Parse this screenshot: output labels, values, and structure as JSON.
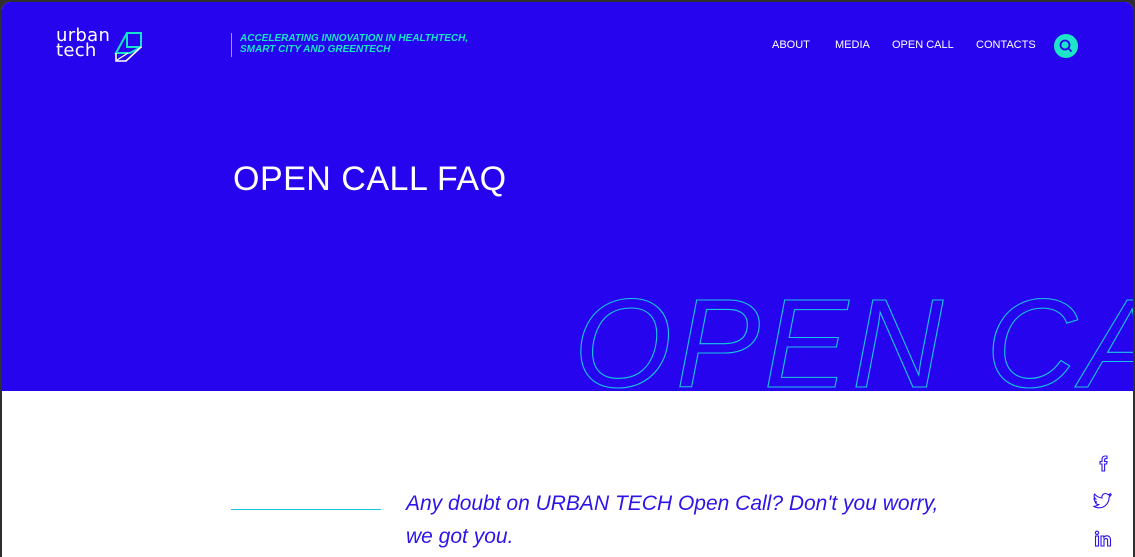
{
  "logo": {
    "line1": "urban",
    "line2": "tech"
  },
  "tagline": {
    "line1": "ACCELERATING INNOVATION IN HEALTHTECH,",
    "line2": "SMART CITY AND GREENTECH"
  },
  "nav": {
    "items": [
      {
        "label": "ABOUT"
      },
      {
        "label": "MEDIA"
      },
      {
        "label": "OPEN CALL"
      },
      {
        "label": "CONTACTS"
      }
    ]
  },
  "hero": {
    "title": "OPEN CALL FAQ",
    "background_text": "OPEN CALL"
  },
  "intro": {
    "line1": "Any doubt on URBAN TECH Open Call? Don't you worry,",
    "line2": "we got you."
  },
  "social": {
    "icons": [
      "facebook-icon",
      "twitter-icon",
      "linkedin-icon"
    ]
  },
  "colors": {
    "hero_bg": "#2605EE",
    "accent_teal": "#16E3C9",
    "accent_cyan": "#16C6E0",
    "intro_text": "#2D14E8"
  }
}
